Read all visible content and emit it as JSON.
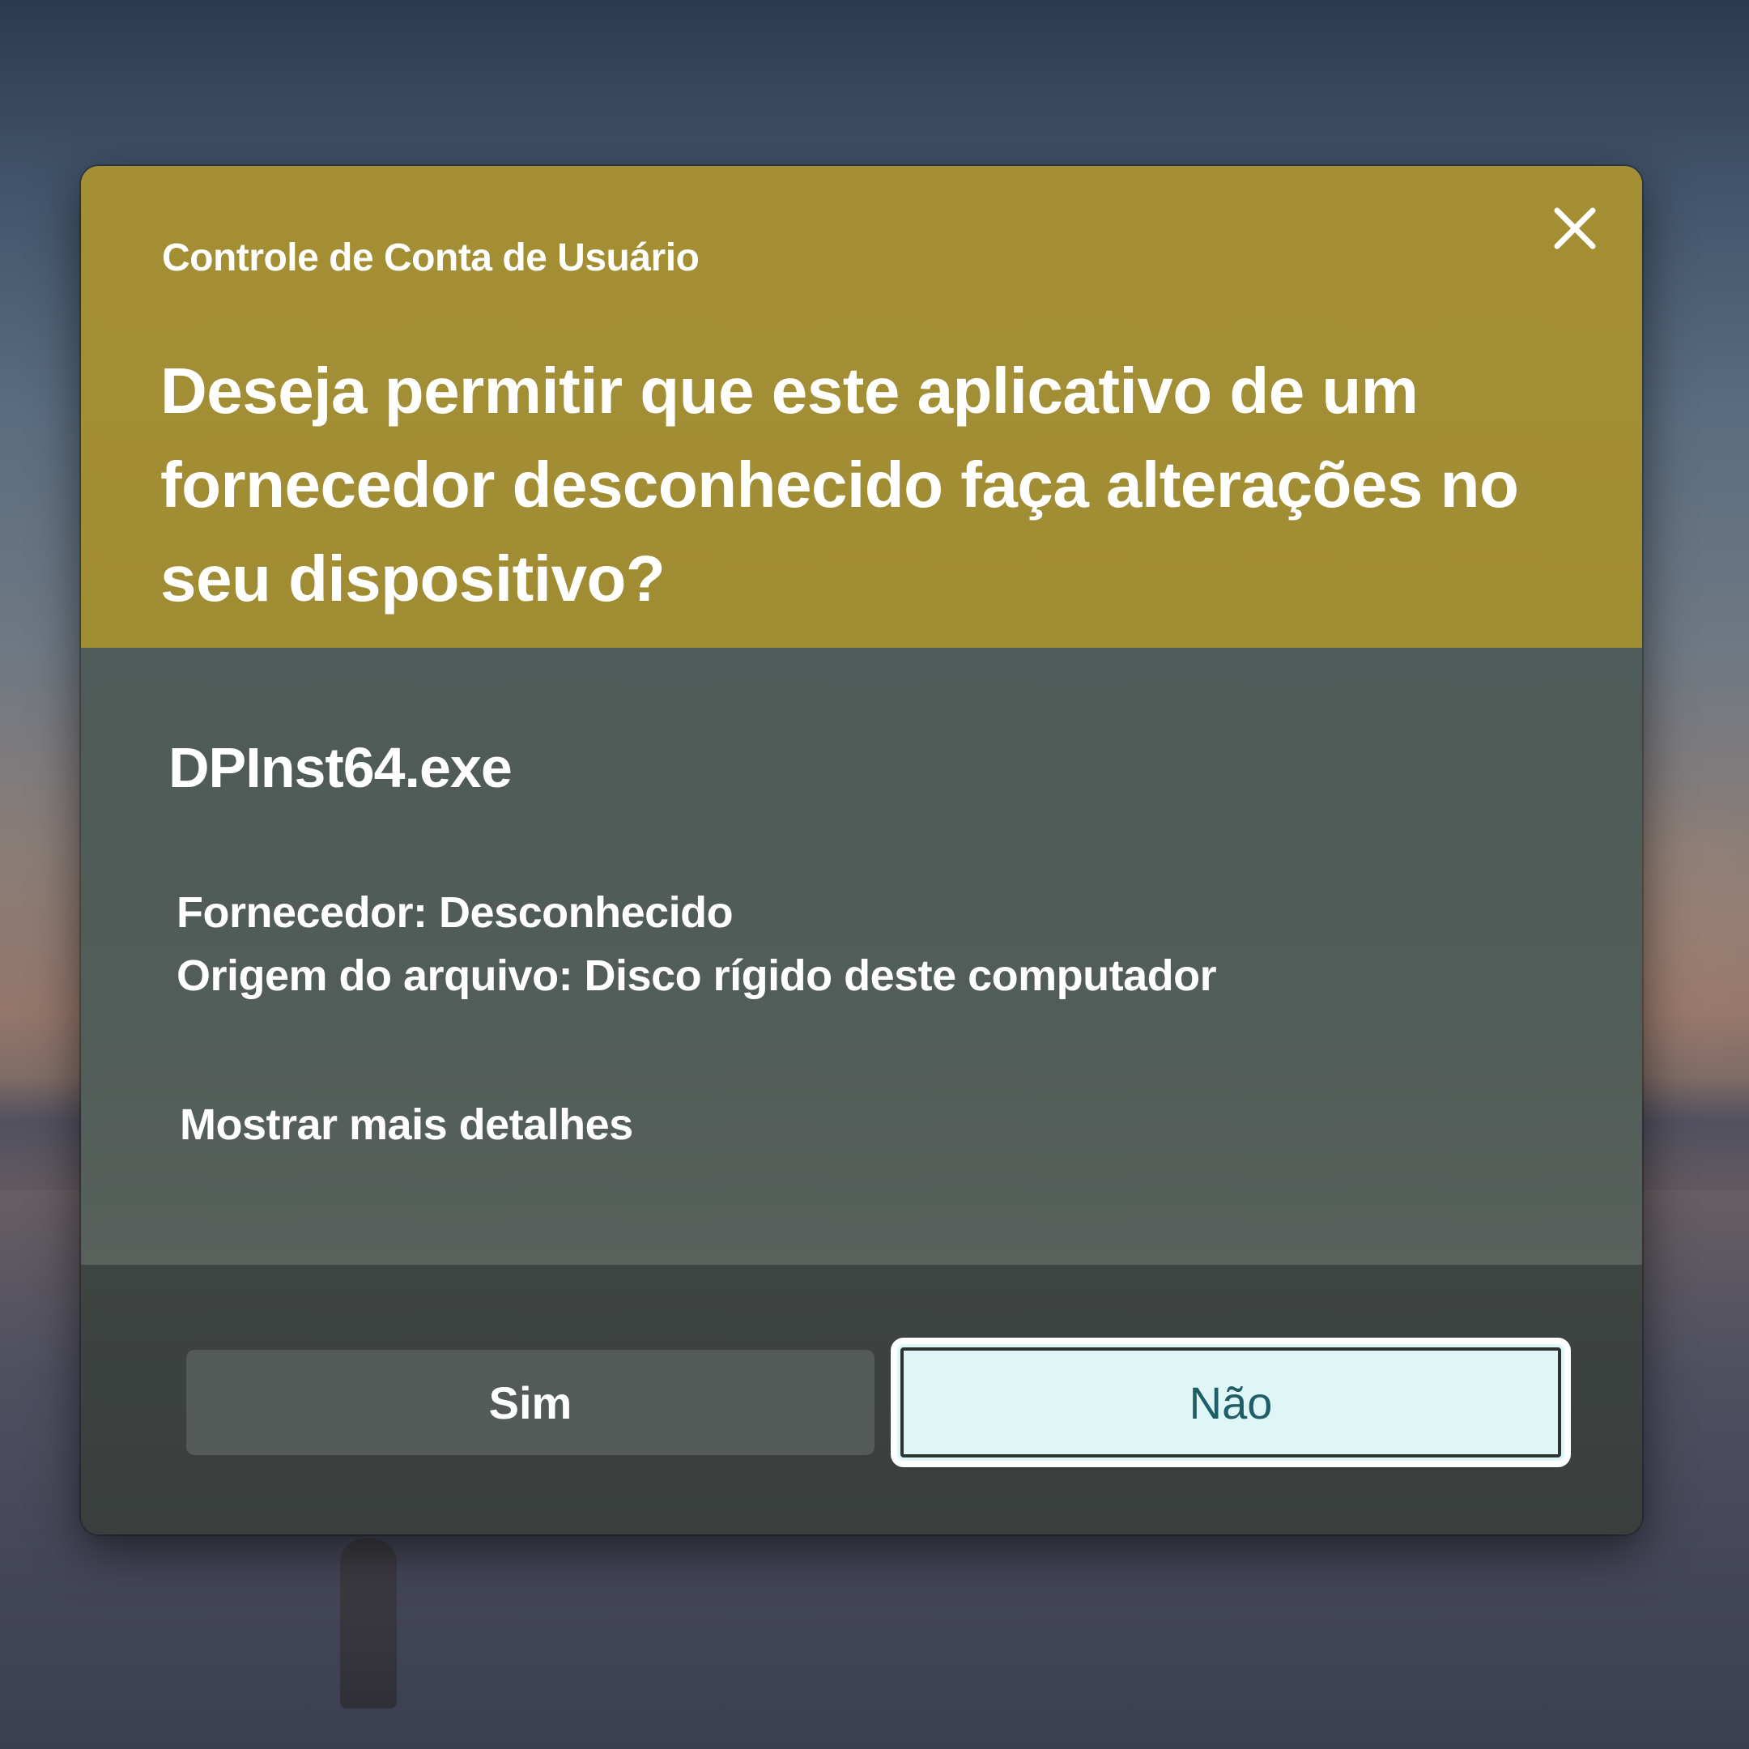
{
  "dialog": {
    "caption": "Controle de Conta de Usuário",
    "question": "Deseja permitir que este aplicativo de um fornecedor desconhecido faça alterações no seu dispositivo?",
    "app_name": "DPInst64.exe",
    "publisher": "Fornecedor: Desconhecido",
    "file_origin": "Origem do arquivo: Disco rígido deste computador",
    "show_more": "Mostrar mais detalhes",
    "yes_label": "Sim",
    "no_label": "Não",
    "close_icon": "close-icon"
  },
  "colors": {
    "header_bg": "#a48f34",
    "body_bg": "#525c58",
    "footer_bg": "#3c4240",
    "no_button_bg": "#dff6f6",
    "no_button_text": "#1f5e66"
  }
}
